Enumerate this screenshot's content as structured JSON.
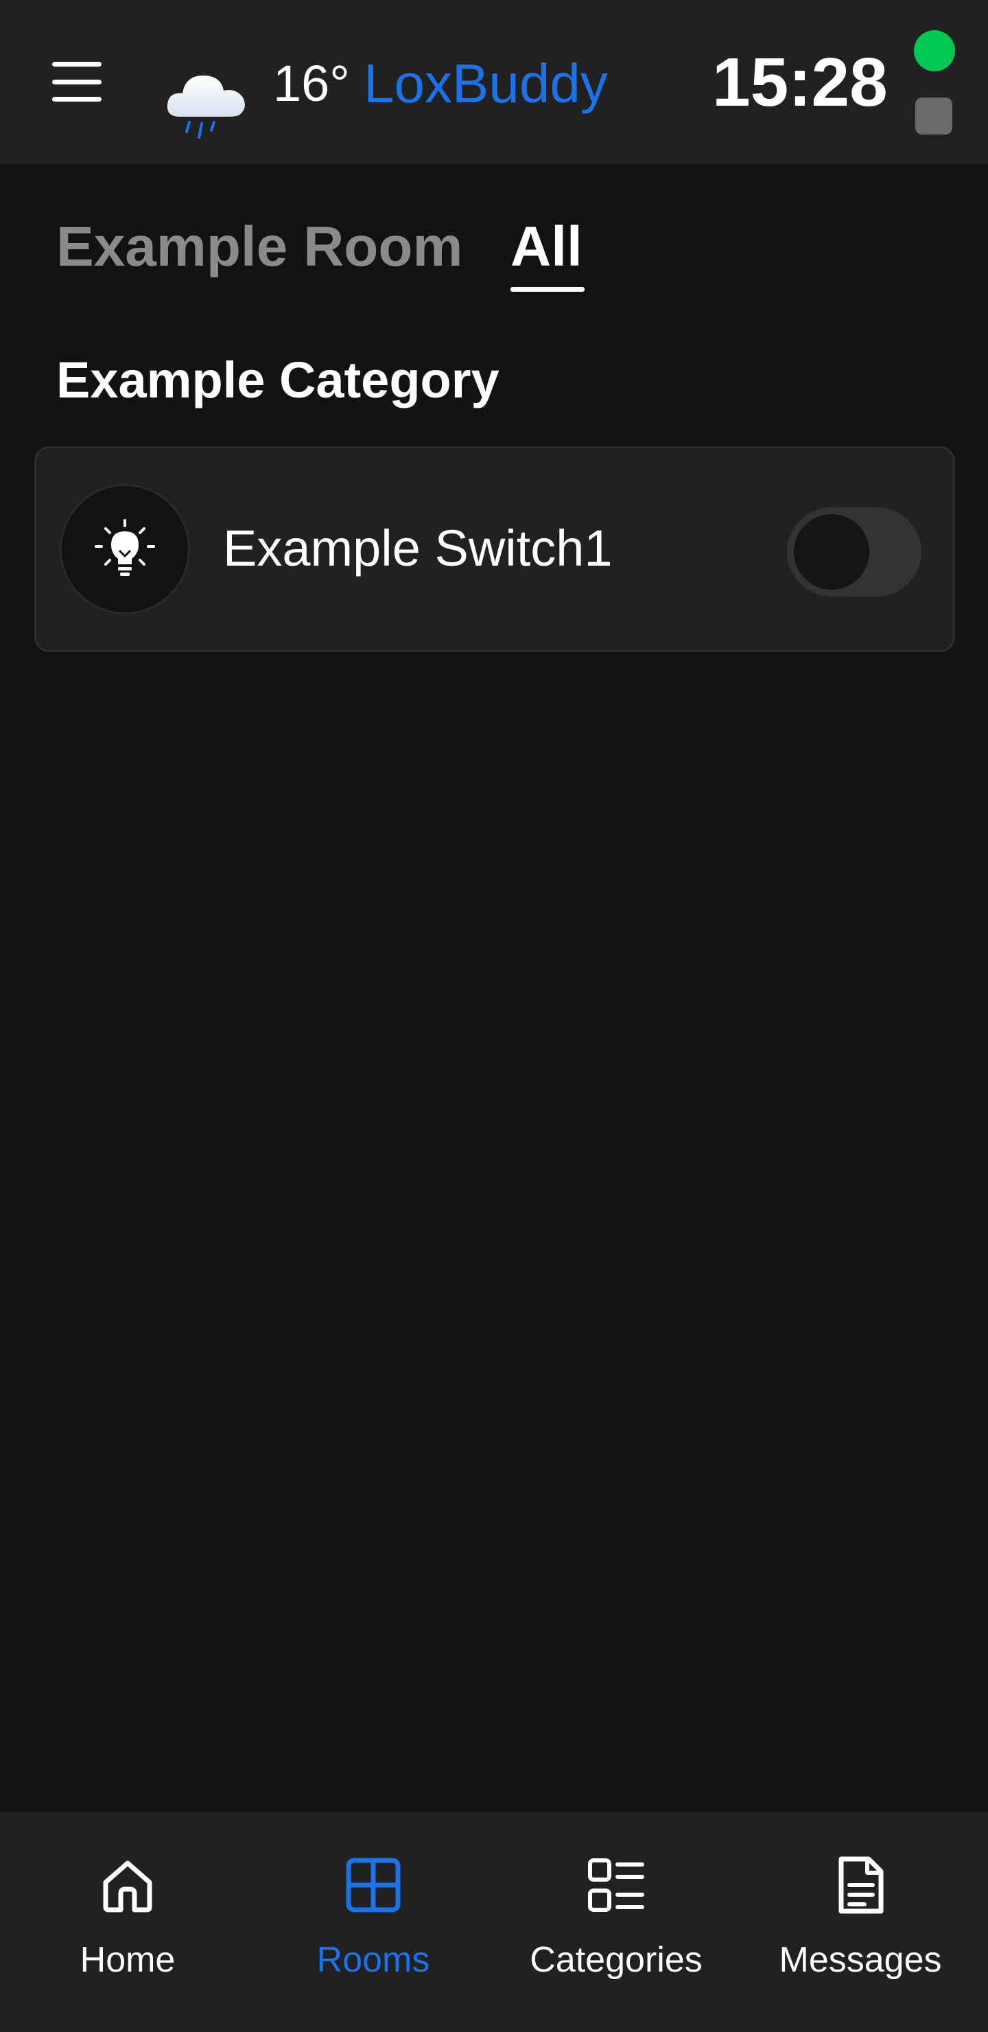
{
  "header": {
    "temperature": "16°",
    "brand": "LoxBuddy",
    "time": "15:28",
    "weather_icon": "rain-cloud-icon",
    "status_online_color": "#00c853",
    "brand_color": "#1a73e8"
  },
  "tabs": [
    {
      "label": "Example Room",
      "active": false
    },
    {
      "label": "All",
      "active": true
    }
  ],
  "category": {
    "title": "Example Category",
    "controls": [
      {
        "label": "Example Switch1",
        "icon": "lightbulb-icon",
        "state": "off"
      }
    ]
  },
  "bottom_nav": {
    "items": [
      {
        "label": "Home",
        "icon": "home-icon",
        "active": false
      },
      {
        "label": "Rooms",
        "icon": "grid-icon",
        "active": true
      },
      {
        "label": "Categories",
        "icon": "list-icon",
        "active": false
      },
      {
        "label": "Messages",
        "icon": "document-icon",
        "active": false
      }
    ]
  }
}
